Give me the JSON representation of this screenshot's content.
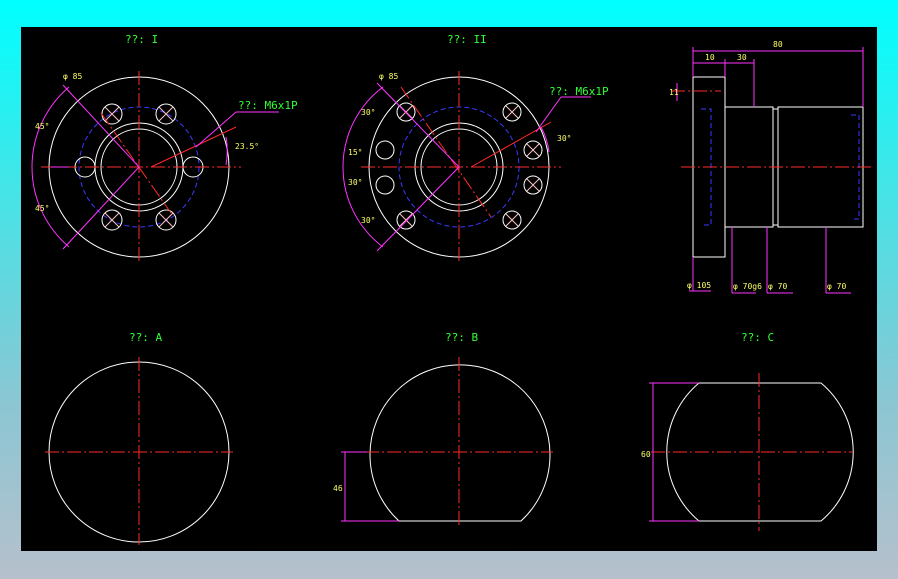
{
  "colors": {
    "background": "#000000",
    "outline": "#ffffff",
    "centerline": "#ff2a2a",
    "hidden": "#3a3aff",
    "dimension": "#ff33ff",
    "label": "#33ff33",
    "hole": "#ffc0c0",
    "dim_text": "#ffff66"
  },
  "views": {
    "view1": {
      "title": "??: I"
    },
    "view2": {
      "title": "??: II"
    },
    "view3": {
      "title": "??: A"
    },
    "view4": {
      "title": "??: B"
    },
    "view5": {
      "title": "??: C"
    }
  },
  "dims": {
    "v1_bolt_circle": "φ 85",
    "v1_angle_top": "45°",
    "v1_angle_bot": "45°",
    "v1_oil_label": "??: M6x1P",
    "v1_offset": "23.5°",
    "v2_bolt_circle": "φ 85",
    "v2_a1": "30°",
    "v2_a2": "15°",
    "v2_a3": "30°",
    "v2_a4": "30°",
    "v2_a5": "30°",
    "v2_oil_label": "??: M6x1P",
    "side_w1": "10",
    "side_w2": "30",
    "side_total": "80",
    "side_h": "11",
    "side_d1": "φ 105",
    "side_d2": "φ 70g6",
    "side_d3": "φ 70",
    "side_d4": "φ 70",
    "b_height": "46",
    "c_height": "60"
  }
}
